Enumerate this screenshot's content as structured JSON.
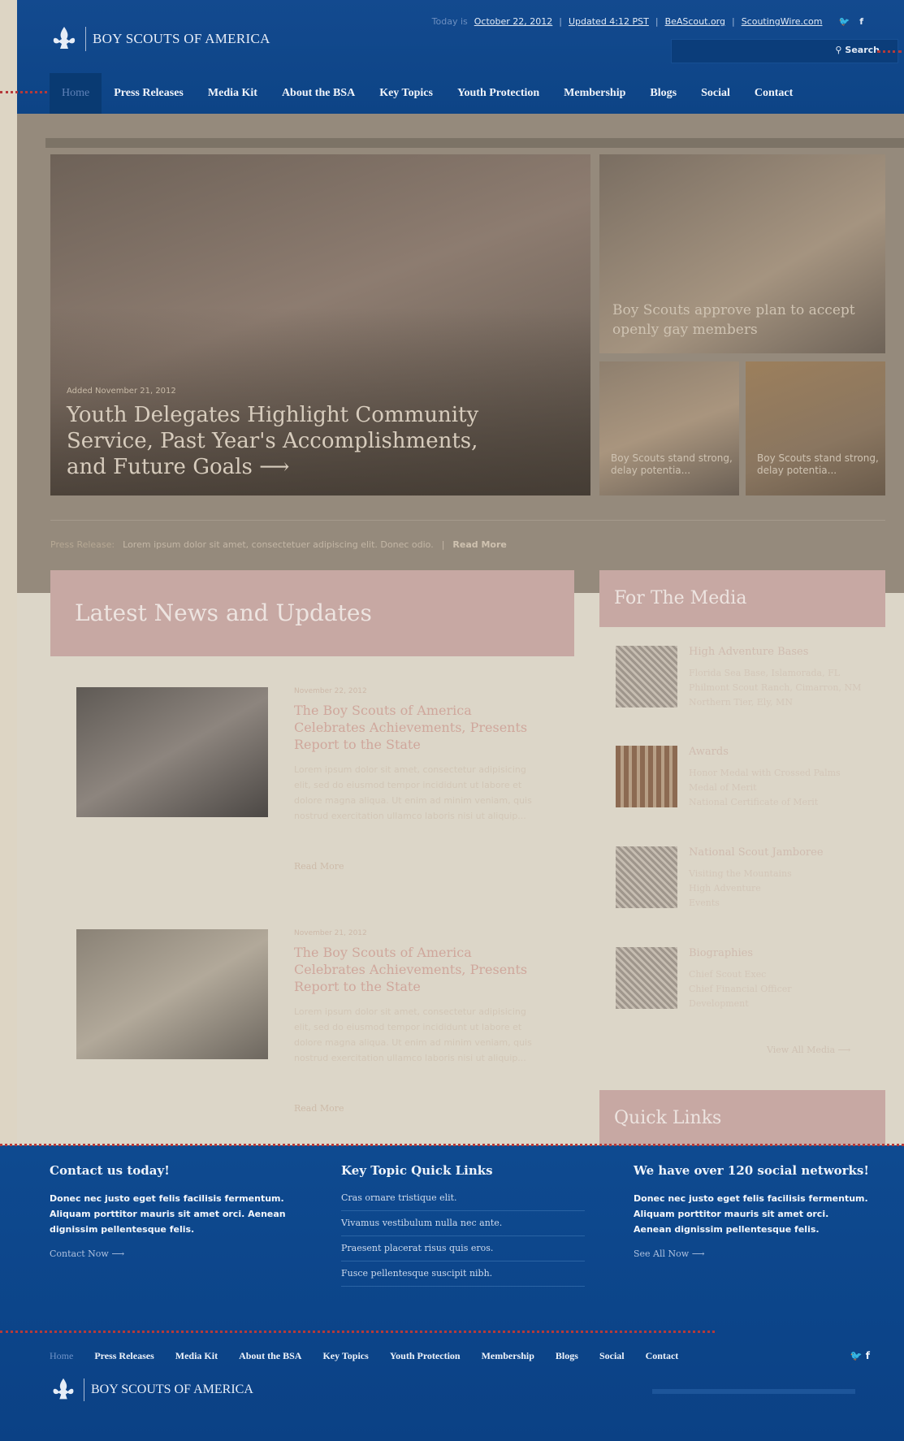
{
  "brand": {
    "name": "BOY SCOUTS OF AMERICA"
  },
  "topbar": {
    "today_label": "Today is",
    "date_text": "October 22, 2012",
    "updated_text": "Updated 4:12 PST",
    "link_1": "BeAScout.org",
    "link_2": "ScoutingWire.com",
    "twitter_icon": "twitter-icon",
    "facebook_icon": "facebook-icon",
    "search_label": "Search"
  },
  "nav": {
    "items": [
      "Home",
      "Press Releases",
      "Media Kit",
      "About the BSA",
      "Key Topics",
      "Youth Protection",
      "Membership",
      "Blogs",
      "Social",
      "Contact"
    ]
  },
  "hero": {
    "date": "Added November 21, 2012",
    "title": "Youth Delegates Highlight Community Service, Past Year's Accomplishments, and Future Goals",
    "arrow": "⟶",
    "side_top_caption": "Boy Scouts approve plan to accept openly gay members",
    "side_a_caption": "Boy Scouts stand strong, delay potentia...",
    "side_b_caption": "Boy Scouts stand strong, delay potentia..."
  },
  "press": {
    "label": "Press Release:",
    "text": "Lorem ipsum dolor sit amet, consectetuer adipiscing elit. Donec odio.",
    "sep": "|",
    "more": "Read More"
  },
  "news": {
    "heading": "Latest News and Updates",
    "items": [
      {
        "date": "November 22, 2012",
        "title": "The Boy Scouts of America Celebrates Achievements, Presents Report to the State",
        "body": "Lorem ipsum dolor sit amet, consectetur adipisicing elit, sed do eiusmod tempor incididunt ut labore et dolore magna aliqua. Ut enim ad minim veniam, quis nostrud exercitation ullamco laboris nisi ut aliquip...",
        "more": "Read More"
      },
      {
        "date": "November 21, 2012",
        "title": "The Boy Scouts of America Celebrates Achievements, Presents Report to the State",
        "body": "Lorem ipsum dolor sit amet, consectetur adipisicing elit, sed do eiusmod tempor incididunt ut labore et dolore magna aliqua. Ut enim ad minim veniam, quis nostrud exercitation ullamco laboris nisi ut aliquip...",
        "more": "Read More"
      }
    ]
  },
  "media": {
    "heading": "For The Media",
    "items": [
      {
        "title": "High Adventure Bases",
        "lines": [
          "Florida Sea Base, Islamorada, FL",
          "Philmont Scout Ranch, Cimarron, NM",
          "Northern Tier, Ely, MN"
        ]
      },
      {
        "title": "Awards",
        "lines": [
          "Honor Medal with Crossed Palms",
          "Medal of Merit",
          "National Certificate of Merit"
        ]
      },
      {
        "title": "National Scout Jamboree",
        "lines": [
          "Visiting the Mountains",
          "High Adventure",
          "Events"
        ]
      },
      {
        "title": "Biographies",
        "lines": [
          "Chief Scout Exec",
          "Chief Financial Officer",
          "Development"
        ]
      }
    ],
    "view_all": "View All Media ⟶"
  },
  "quick_links": {
    "heading": "Quick Links"
  },
  "footer": {
    "col1": {
      "heading": "Contact us today!",
      "text": "Donec nec justo eget felis facilisis fermentum. Aliquam porttitor mauris sit amet orci. Aenean dignissim pellentesque felis.",
      "cta": "Contact Now ⟶"
    },
    "col2": {
      "heading": "Key Topic Quick Links",
      "links": [
        "Cras ornare tristique elit.",
        "Vivamus vestibulum nulla nec ante.",
        "Praesent placerat risus quis eros.",
        "Fusce pellentesque suscipit nibh."
      ]
    },
    "col3": {
      "heading": "We have over 120 social networks!",
      "text": "Donec nec justo eget felis facilisis fermentum. Aliquam porttitor mauris sit amet orci. Aenean dignissim pellentesque felis.",
      "cta": "See All Now ⟶"
    },
    "nav": [
      "Home",
      "Press Releases",
      "Media Kit",
      "About the BSA",
      "Key Topics",
      "Youth Protection",
      "Membership",
      "Blogs",
      "Social",
      "Contact"
    ],
    "social": "🐦 f"
  },
  "colors": {
    "header_blue": "#0f4788",
    "accent_rose": "#c7a8a3",
    "annotation_red": "#b53a3a"
  }
}
